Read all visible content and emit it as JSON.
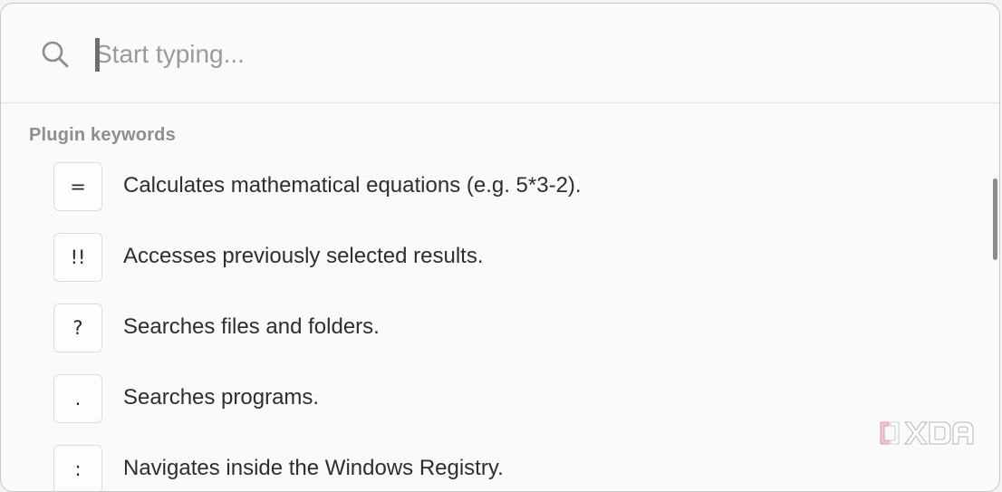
{
  "search": {
    "placeholder": "Start typing...",
    "value": "",
    "icon": "search-icon"
  },
  "plugins": {
    "header": "Plugin keywords",
    "items": [
      {
        "key": "=",
        "description": "Calculates mathematical equations (e.g. 5*3-2)."
      },
      {
        "key": "!!",
        "description": "Accesses previously selected results."
      },
      {
        "key": "?",
        "description": "Searches files and folders."
      },
      {
        "key": ".",
        "description": "Searches programs."
      },
      {
        "key": ":",
        "description": "Navigates inside the Windows Registry."
      }
    ]
  },
  "watermark": {
    "text": "XDA"
  },
  "colors": {
    "background": "#fafafa",
    "text": "#2e2e2e",
    "muted": "#8e8e8e",
    "placeholder": "#9a9a9a",
    "border": "#dcdcdc",
    "scrollbar": "#8a8a8a"
  }
}
